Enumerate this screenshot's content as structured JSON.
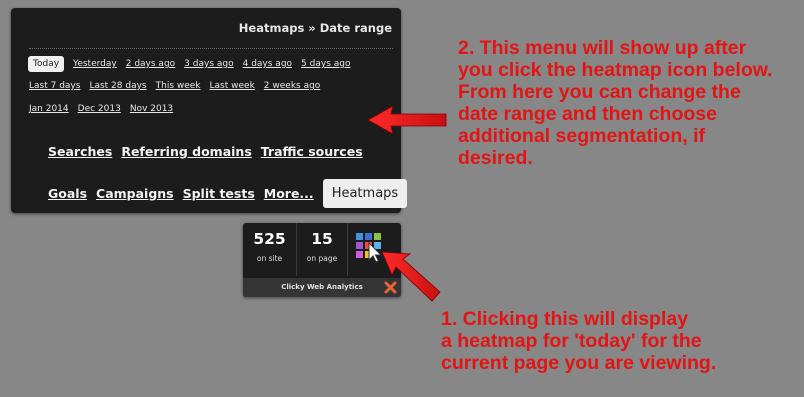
{
  "panel": {
    "title": "Heatmaps » Date range",
    "date_rows": [
      [
        "Today",
        "Yesterday",
        "2 days ago",
        "3 days ago",
        "4 days ago",
        "5 days ago"
      ],
      [
        "Last 7 days",
        "Last 28 days",
        "This week",
        "Last week",
        "2 weeks ago"
      ],
      [
        "Jan 2014",
        "Dec 2013",
        "Nov 2013"
      ]
    ],
    "nav_row1": [
      "Searches",
      "Referring domains",
      "Traffic sources"
    ],
    "nav_row2": [
      "Goals",
      "Campaigns",
      "Split tests",
      "More..."
    ],
    "heatmaps_button": "Heatmaps"
  },
  "widget": {
    "on_site_value": "525",
    "on_site_label": "on site",
    "on_page_value": "15",
    "on_page_label": "on page",
    "footer": "Clicky Web Analytics",
    "heatmap_icon": "heatmap-grid-icon",
    "close_icon": "close-x-icon"
  },
  "annotations": {
    "menu_note": [
      "2. This menu will show up after",
      "you click the heatmap icon below.",
      "From here you can change the",
      "date range and then choose",
      "additional segmentation, if",
      "desired."
    ],
    "icon_note": [
      "1. Clicking this will display",
      "a heatmap for 'today' for the",
      "current page you are viewing."
    ]
  },
  "colors": {
    "background": "#878787",
    "panel": "#1c1c1c",
    "annotation_red": "#e31414"
  }
}
